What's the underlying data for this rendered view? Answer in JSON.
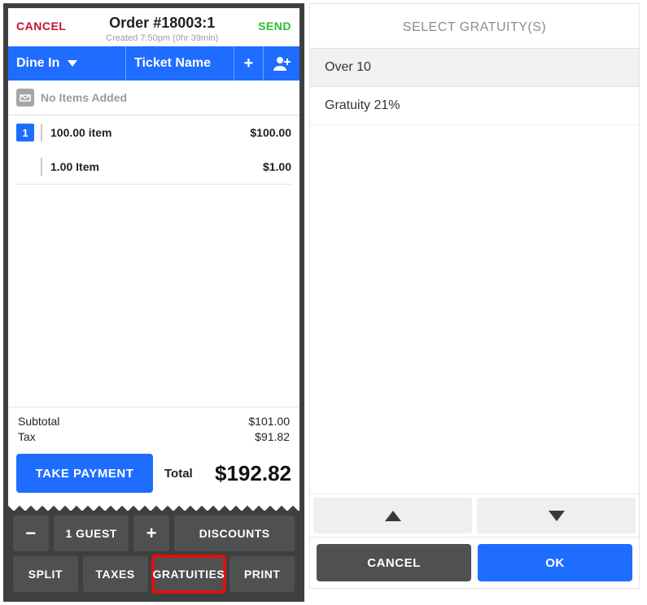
{
  "order": {
    "cancel": "CANCEL",
    "title": "Order #18003:1",
    "meta": "Created 7:50pm (0hr 39min)",
    "send": "SEND",
    "dine_in": "Dine In",
    "ticket_name": "Ticket Name",
    "no_items": "No Items Added",
    "items": [
      {
        "qty": "1",
        "name": "100.00 item",
        "price": "$100.00"
      },
      {
        "qty": "",
        "name": "1.00 Item",
        "price": "$1.00"
      }
    ],
    "subtotal_label": "Subtotal",
    "subtotal_value": "$101.00",
    "tax_label": "Tax",
    "tax_value": "$91.82",
    "take_payment": "TAKE PAYMENT",
    "total_label": "Total",
    "total_value": "$192.82",
    "guest_btn": "1 GUEST",
    "discounts_btn": "DISCOUNTS",
    "split_btn": "SPLIT",
    "taxes_btn": "TAXES",
    "gratuities_btn": "GRATUITIES",
    "print_btn": "PRINT"
  },
  "modal": {
    "title": "SELECT GRATUITY(S)",
    "options": [
      {
        "label": "Over 10",
        "selected": true
      },
      {
        "label": "Gratuity 21%",
        "selected": false
      }
    ],
    "cancel": "CANCEL",
    "ok": "OK"
  }
}
